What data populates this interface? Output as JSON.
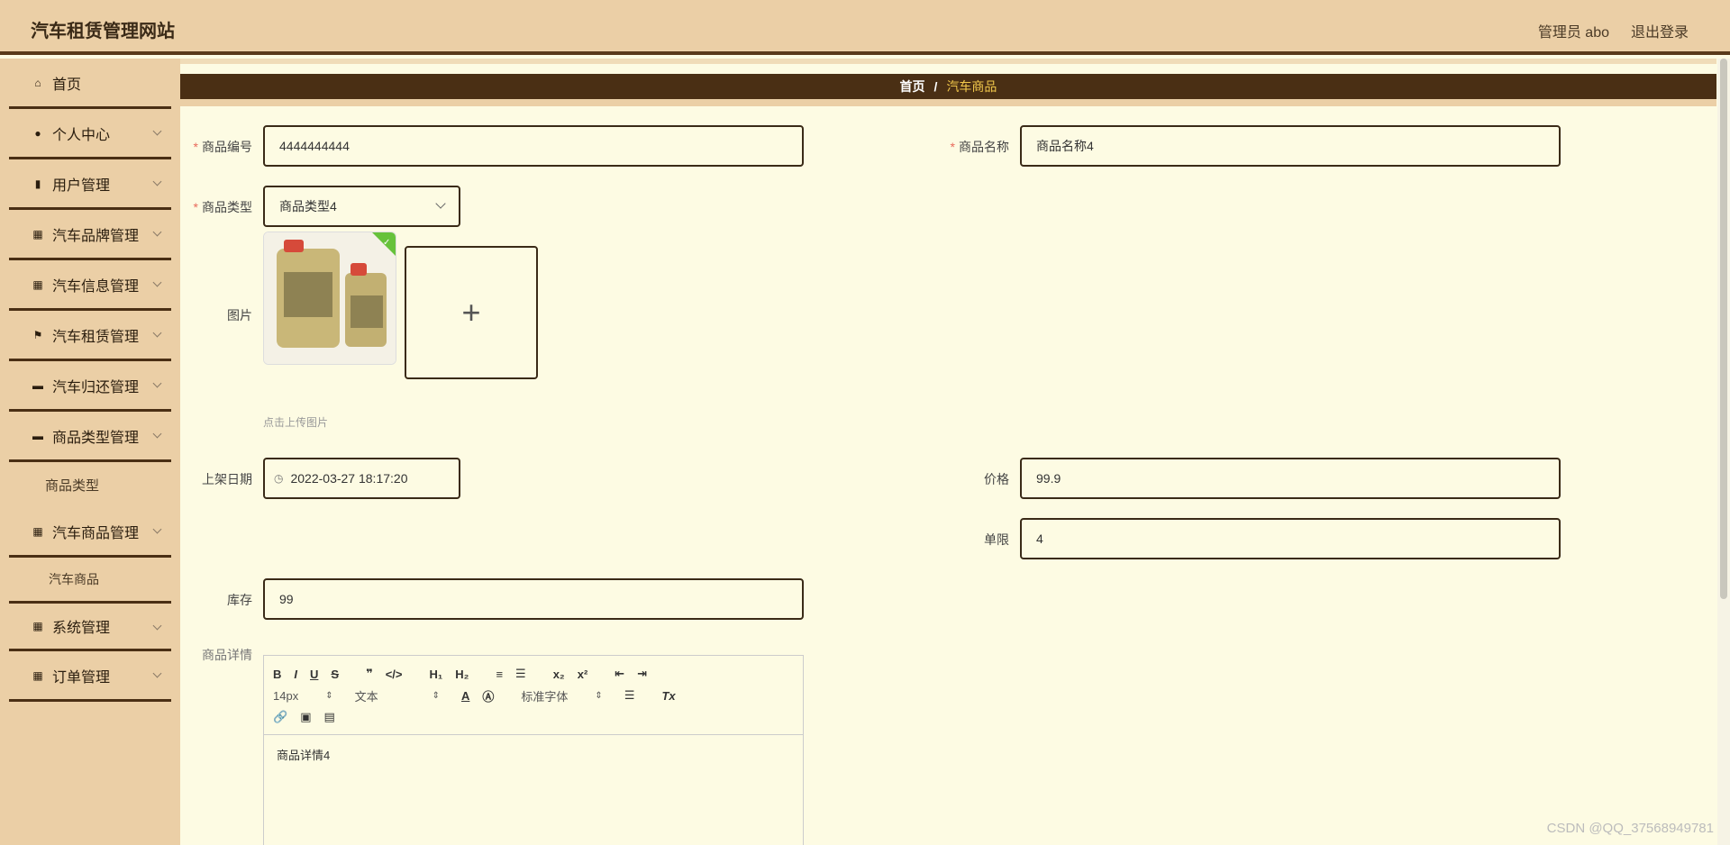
{
  "header": {
    "title": "汽车租赁管理网站",
    "user": "管理员 abo",
    "logout": "退出登录"
  },
  "sidebar": {
    "items": [
      {
        "label": "首页",
        "icon": "home-icon"
      },
      {
        "label": "个人中心",
        "icon": "user-icon"
      },
      {
        "label": "用户管理",
        "icon": "clipboard-icon"
      },
      {
        "label": "汽车品牌管理",
        "icon": "grid-icon"
      },
      {
        "label": "汽车信息管理",
        "icon": "grid-icon"
      },
      {
        "label": "汽车租赁管理",
        "icon": "flag-icon"
      },
      {
        "label": "汽车归还管理",
        "icon": "monitor-icon"
      },
      {
        "label": "商品类型管理",
        "icon": "comment-icon"
      },
      {
        "label": "汽车商品管理",
        "icon": "apps-icon"
      },
      {
        "label": "系统管理",
        "icon": "grid-icon"
      },
      {
        "label": "订单管理",
        "icon": "grid-icon"
      }
    ],
    "sub_goods_type": "商品类型",
    "sub_car_goods": "汽车商品"
  },
  "breadcrumb": {
    "home": "首页",
    "separator": "/",
    "current": "汽车商品"
  },
  "form": {
    "goods_no": {
      "label": "商品编号",
      "value": "4444444444"
    },
    "goods_name": {
      "label": "商品名称",
      "value": "商品名称4"
    },
    "goods_type": {
      "label": "商品类型",
      "value": "商品类型4"
    },
    "picture": {
      "label": "图片",
      "hint": "点击上传图片"
    },
    "shelf_date": {
      "label": "上架日期",
      "value": "2022-03-27 18:17:20"
    },
    "price": {
      "label": "价格",
      "value": "99.9"
    },
    "limit": {
      "label": "单限",
      "value": "4"
    },
    "stock": {
      "label": "库存",
      "value": "99"
    },
    "detail": {
      "label": "商品详情",
      "font_size": "14px",
      "text_type": "文本",
      "font_family": "标准字体",
      "content": "商品详情4"
    }
  },
  "watermark": "CSDN @QQ_37568949781",
  "colors": {
    "header_bg": "#ebcfa6",
    "dark_brown": "#4a2f14",
    "page_bg": "#fdfbe3",
    "accent_yellow": "#f2c84b"
  }
}
